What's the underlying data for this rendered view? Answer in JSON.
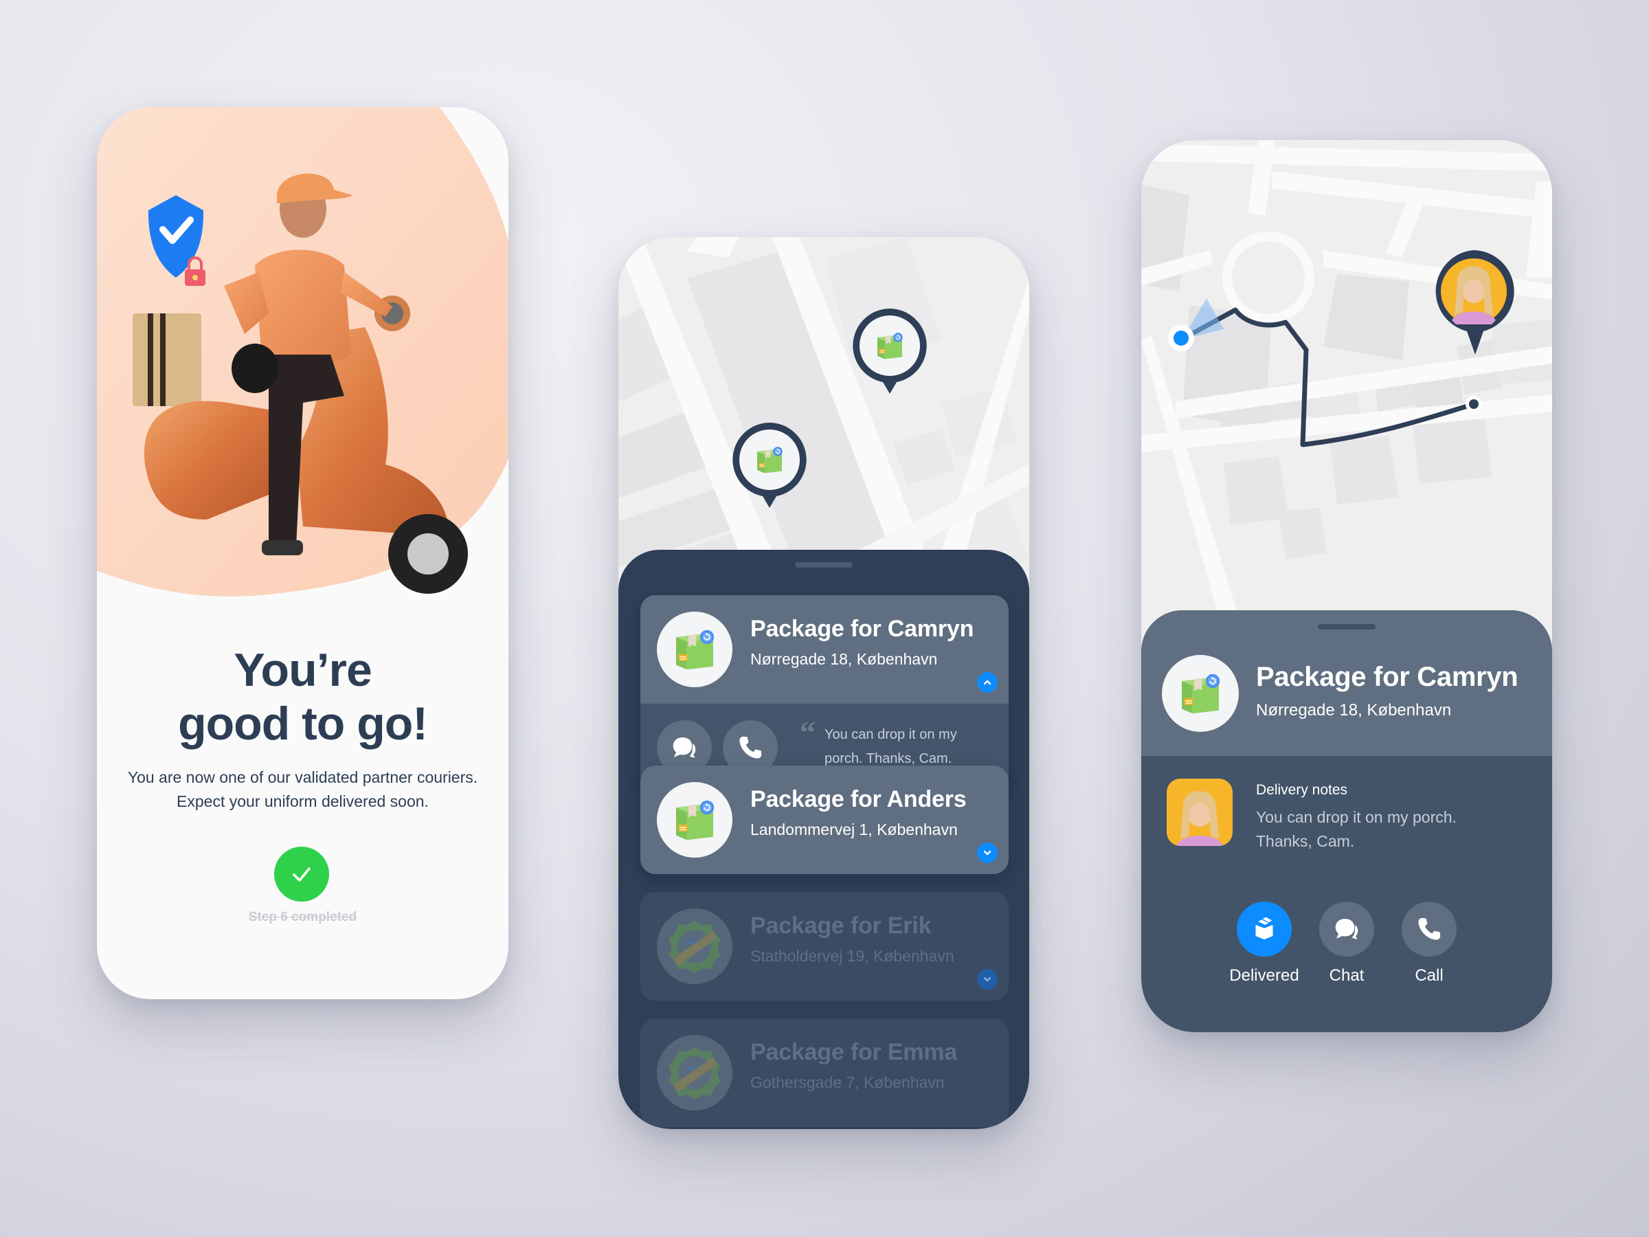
{
  "onboarding": {
    "title_line1": "You’re",
    "title_line2": "good to go!",
    "description": "You are now one of our validated partner couriers. Expect your uniform delivered soon.",
    "step_label": "Step 6 completed",
    "illustration": "courier-on-scooter-with-shield",
    "colors": {
      "blob": "#fcd9c4",
      "check": "#2fd14a",
      "title": "#2d3e54"
    }
  },
  "package_list": {
    "map_pins": [
      {
        "icon": "package-icon"
      },
      {
        "icon": "package-icon"
      }
    ],
    "packages": [
      {
        "title": "Package for Camryn",
        "address": "Nørregade 18, København",
        "state": "expanded",
        "icon": "package-icon",
        "note": "You can drop it on my porch. Thanks, Cam.",
        "actions": [
          "Chat",
          "Call"
        ]
      },
      {
        "title": "Package for Anders",
        "address": "Landommervej 1, København",
        "state": "collapsed",
        "icon": "package-icon"
      },
      {
        "title": "Package for Erik",
        "address": "Statholdervej 19, København",
        "state": "delivered",
        "icon": "delivered-badge-icon"
      },
      {
        "title": "Package for Emma",
        "address": "Gothersgade 7, København",
        "state": "delivered",
        "icon": "delivered-badge-icon"
      }
    ]
  },
  "delivery_detail": {
    "title": "Package for Camryn",
    "address": "Nørregade 18, København",
    "notes_label": "Delivery notes",
    "notes": "You can drop it on my porch. Thanks, Cam.",
    "actions": [
      {
        "label": "Delivered",
        "icon": "package-open-icon",
        "primary": true
      },
      {
        "label": "Chat",
        "icon": "chat-icon",
        "primary": false
      },
      {
        "label": "Call",
        "icon": "phone-icon",
        "primary": false
      }
    ],
    "colors": {
      "accent": "#0d8cff",
      "route": "#2e3f57",
      "avatar_bg": "#f7b52a"
    }
  }
}
